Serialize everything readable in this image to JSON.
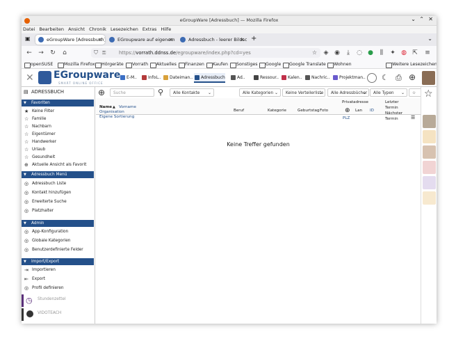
{
  "window": {
    "title": "eGroupWare [Adressbuch] — Mozilla Firefox"
  },
  "menubar": [
    "Datei",
    "Bearbeiten",
    "Ansicht",
    "Chronik",
    "Lesezeichen",
    "Extras",
    "Hilfe"
  ],
  "tabs": [
    {
      "label": "eGroupWare [Adressbuch]"
    },
    {
      "label": "EGroupware auf eigenem"
    },
    {
      "label": "Adressbuch - leerer Bildsc"
    }
  ],
  "url": {
    "scheme": "https://",
    "host": "vorrath.ddnss.de",
    "path": "/egroupware/index.php?cd=yes"
  },
  "bookmarks": [
    "openSUSE",
    "Mozilla Firefox",
    "Hörgeräte",
    "Vorrath",
    "Aktuelles",
    "Finanzen",
    "Kaufen",
    "Sonstiges",
    "Google",
    "Google Translate",
    "Wohnen",
    "Weitere Lesezeichen"
  ],
  "logo": {
    "name": "EGroupware",
    "tagline": "SMART ONLINE OFFICE"
  },
  "apps": [
    {
      "label": "E-M..",
      "color": "#3b6fc4"
    },
    {
      "label": "InfoL..",
      "color": "#b33a3a"
    },
    {
      "label": "Dateiman..",
      "color": "#d9a13b"
    },
    {
      "label": "Adressbuch",
      "color": "#24508a"
    },
    {
      "label": "Ad..",
      "color": "#555555"
    },
    {
      "label": "Ressour..",
      "color": "#444444"
    },
    {
      "label": "Kalen..",
      "color": "#c0304a"
    },
    {
      "label": "Nachric..",
      "color": "#555555"
    },
    {
      "label": "Projektman..",
      "color": "#6a5acd"
    }
  ],
  "sidebar": {
    "title": "ADRESSBUCH",
    "sections": [
      {
        "label": "Favoriten",
        "items": [
          {
            "icon": "★",
            "label": "Keine Filter"
          },
          {
            "icon": "☆",
            "label": "Familie"
          },
          {
            "icon": "☆",
            "label": "Nachbarn"
          },
          {
            "icon": "☆",
            "label": "Eigentümer"
          },
          {
            "icon": "☆",
            "label": "Handwerker"
          },
          {
            "icon": "☆",
            "label": "Urlaub"
          },
          {
            "icon": "☆",
            "label": "Gesundheit"
          },
          {
            "icon": "⊕",
            "label": "Aktuelle Ansicht als Favorit"
          }
        ]
      },
      {
        "label": "Adressbuch Menü",
        "items": [
          {
            "icon": "◎",
            "label": "Adressbuch Liste"
          },
          {
            "icon": "◎",
            "label": "Kontakt hinzufügen"
          },
          {
            "icon": "◎",
            "label": "Erweiterte Suche"
          },
          {
            "icon": "◎",
            "label": "Platzhalter"
          }
        ]
      },
      {
        "label": "Admin",
        "items": [
          {
            "icon": "◎",
            "label": "App-Konfiguration"
          },
          {
            "icon": "◎",
            "label": "Globale Kategorien"
          },
          {
            "icon": "◎",
            "label": "Benutzerdefinierte Felder"
          }
        ]
      },
      {
        "label": "Import/Export",
        "items": [
          {
            "icon": "⇥",
            "label": "Importieren"
          },
          {
            "icon": "⇤",
            "label": "Export"
          },
          {
            "icon": "◎",
            "label": "Profil definieren"
          }
        ]
      }
    ],
    "footer_apps": [
      {
        "label": "Stundenzettel"
      },
      {
        "label": "VIDOTEACH"
      }
    ]
  },
  "toolbar": {
    "search_placeholder": "Suche",
    "filter_contacts": "Alle Kontakte",
    "filter_categories": "Alle Kategorien",
    "filter_distribution": "Keine Verteilerliste",
    "filter_addressbooks": "Alle Adressbücher",
    "filter_types": "Alle Typen",
    "count": "0"
  },
  "table": {
    "col_name": "Name",
    "col_vorname": "Vorname",
    "col_org": "Organisation",
    "col_sort": "Eigene Sortierung",
    "col_beruf": "Beruf",
    "col_kategorie": "Kategorie",
    "col_geburtstag": "Geburtstag",
    "col_foto": "Foto",
    "col_privatadresse": "Privatadresse",
    "col_land": "Lan",
    "col_plz": "PLZ",
    "col_id": "ID",
    "col_letzter_termin": "Letzter Termin",
    "col_naechster_termin": "Nächster Termin",
    "empty_message": "Keine Treffer gefunden"
  }
}
